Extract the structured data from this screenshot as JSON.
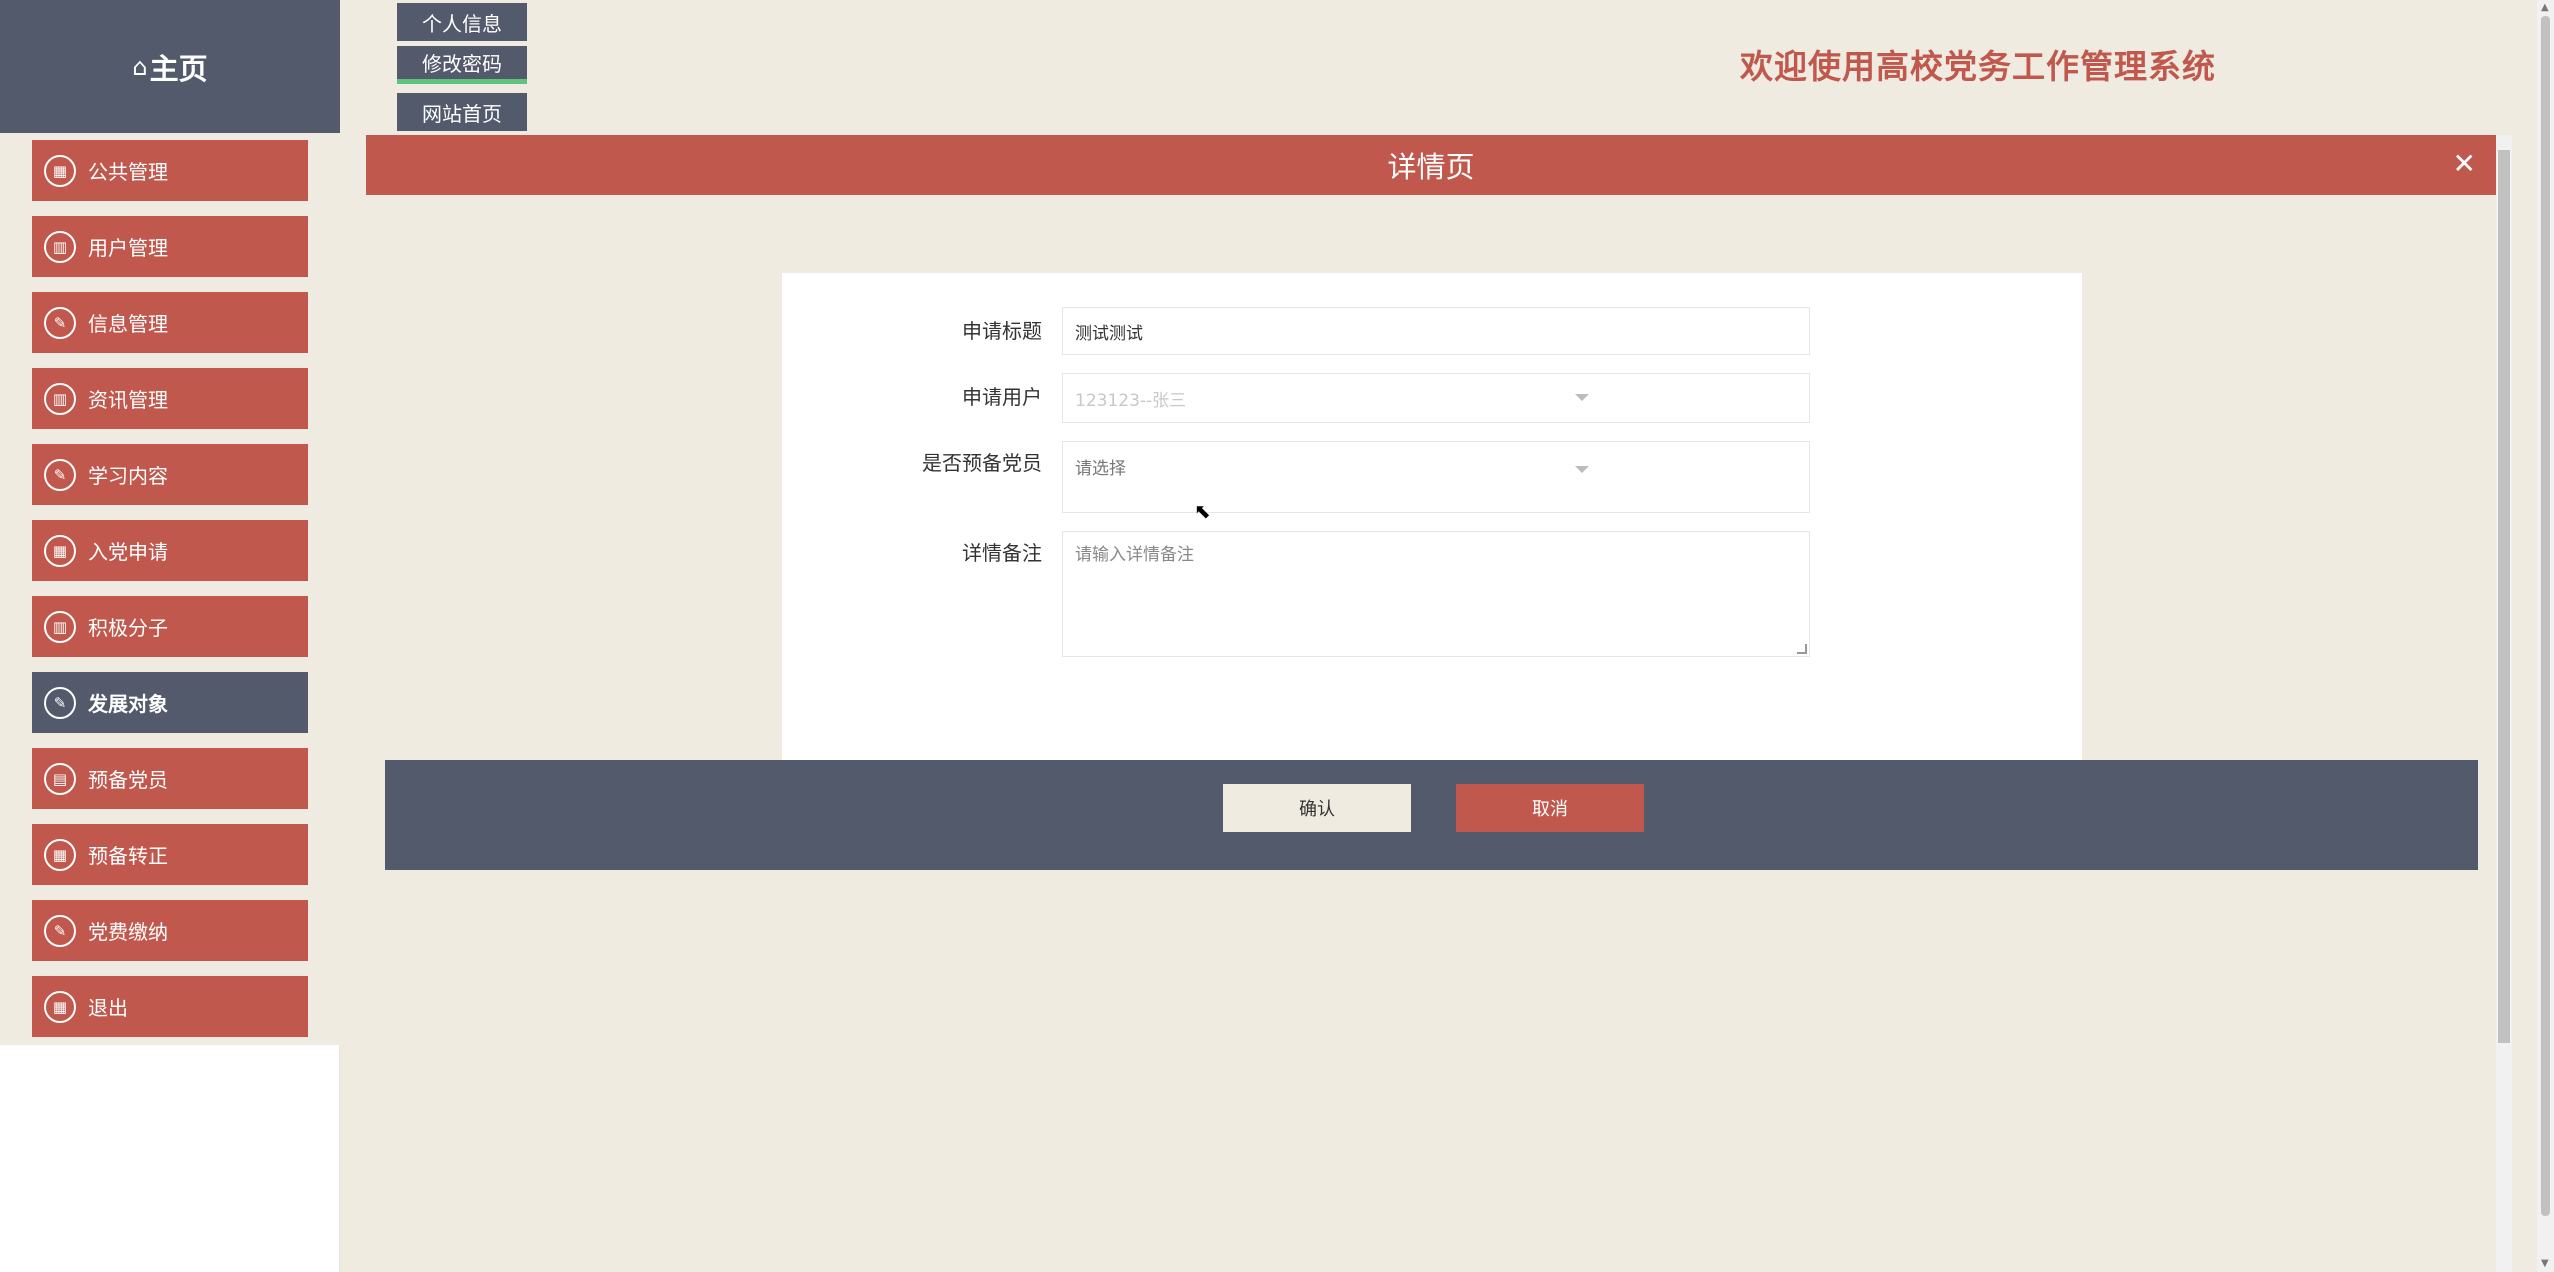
{
  "header": {
    "home_label": "主页",
    "welcome": "欢迎使用高校党务工作管理系统",
    "top_buttons": [
      "个人信息",
      "修改密码",
      "网站首页"
    ]
  },
  "sidebar": {
    "items": [
      {
        "label": "公共管理",
        "icon": "calendar-icon"
      },
      {
        "label": "用户管理",
        "icon": "bar-chart-icon"
      },
      {
        "label": "信息管理",
        "icon": "edit-icon"
      },
      {
        "label": "资讯管理",
        "icon": "bar-chart-icon"
      },
      {
        "label": "学习内容",
        "icon": "edit-icon"
      },
      {
        "label": "入党申请",
        "icon": "calendar-icon"
      },
      {
        "label": "积极分子",
        "icon": "bar-chart-icon"
      },
      {
        "label": "发展对象",
        "icon": "edit-icon",
        "active": true
      },
      {
        "label": "预备党员",
        "icon": "clipboard-icon"
      },
      {
        "label": "预备转正",
        "icon": "calendar-icon"
      },
      {
        "label": "党费缴纳",
        "icon": "edit-icon"
      },
      {
        "label": "退出",
        "icon": "calendar-icon"
      }
    ]
  },
  "detail": {
    "title": "详情页",
    "fields": {
      "apply_title_label": "申请标题",
      "apply_title_value": "测试测试",
      "apply_user_label": "申请用户",
      "apply_user_value": "123123--张三",
      "is_reserve_label": "是否预备党员",
      "is_reserve_placeholder": "请选择",
      "remark_label": "详情备注",
      "remark_placeholder": "请输入详情备注"
    },
    "confirm_label": "确认",
    "cancel_label": "取消"
  },
  "colors": {
    "accent_red": "#c0584d",
    "slate": "#525a6c",
    "beige": "#efebe0",
    "active_underline": "#5fc27e"
  }
}
